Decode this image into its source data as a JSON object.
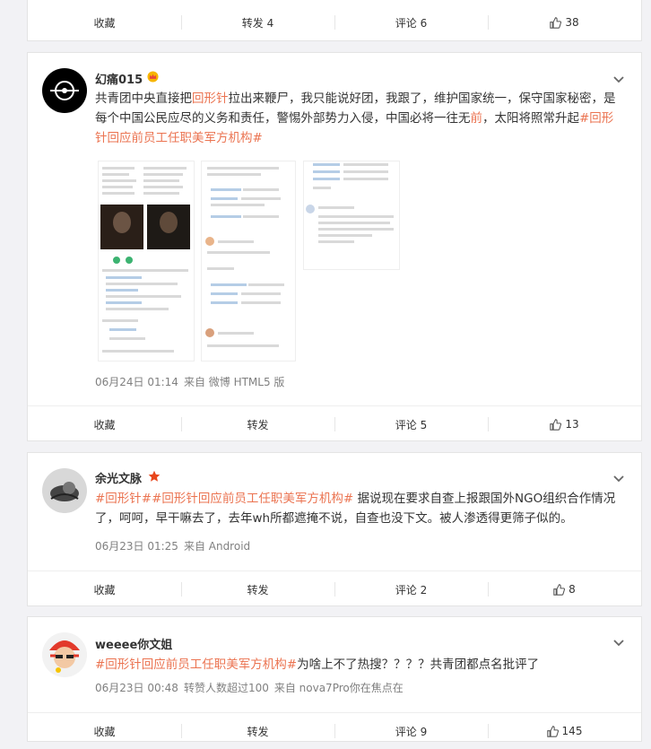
{
  "posts": [
    {
      "actions": {
        "collect": "收藏",
        "repost": "转发 4",
        "comment": "评论 6",
        "like": "38"
      }
    },
    {
      "username": "幻痛015",
      "text_segments": [
        {
          "t": "共青团中央直接把",
          "hl": false
        },
        {
          "t": "回形针",
          "hl": true
        },
        {
          "t": "拉出来鞭尸，我只能说好团，我跟了，维护国家统一，保守国家秘密，是每个中国公民应尽的义务和责任，警惕外部势力入侵，中国必将一往无",
          "hl": false
        },
        {
          "t": "前",
          "hl": true
        },
        {
          "t": "，太阳将照常升起",
          "hl": false
        },
        {
          "t": "#回形针回应前员工任职美军方机构#",
          "hl": true
        }
      ],
      "meta": {
        "time": "06月24日 01:14",
        "source": "来自 微博 HTML5 版"
      },
      "actions": {
        "collect": "收藏",
        "repost": "转发",
        "comment": "评论 5",
        "like": "13"
      }
    },
    {
      "username": "余光文脉",
      "text_segments": [
        {
          "t": "#回形针##回形针回应前员工任职美军方机构#",
          "hl": true
        },
        {
          "t": " 据说现在要求自查上报跟国外NGO组织合作情况了，呵呵，早干嘛去了，去年wh所都遮掩不说，自查也没下文。被人渗透得更筛子似的。",
          "hl": false
        }
      ],
      "meta": {
        "time": "06月23日 01:25",
        "source": "来自 Android"
      },
      "actions": {
        "collect": "收藏",
        "repost": "转发",
        "comment": "评论 2",
        "like": "8"
      }
    },
    {
      "username": "weeee你文姐",
      "text_segments": [
        {
          "t": "#回形针回应前员工任职美军方机构#",
          "hl": true
        },
        {
          "t": "为啥上不了热搜？？？？共青团都点名批评了",
          "hl": false
        }
      ],
      "meta": {
        "time": "06月23日 00:48",
        "reposts": "转赞人数超过100",
        "source": "来自 nova7Pro你在焦点在"
      },
      "actions": {
        "collect": "收藏",
        "repost": "转发",
        "comment": "评论 9",
        "like": "145"
      }
    }
  ],
  "icons": {
    "like": "thumbs-up-icon",
    "more": "chevron-down-icon",
    "crown": "crown-badge-icon",
    "star": "star-badge-icon"
  },
  "colors": {
    "highlight": "#eb7350",
    "meta": "#808080",
    "background": "#f2f2f5"
  }
}
